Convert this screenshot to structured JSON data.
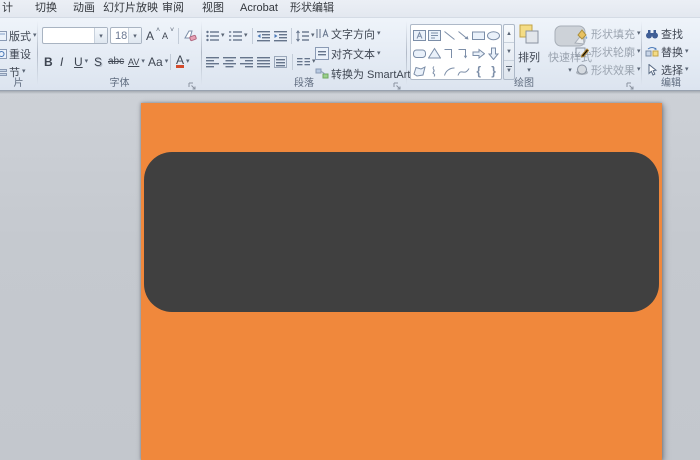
{
  "colors": {
    "slide_background": "#F0883C",
    "shape_fill": "#404040",
    "workspace_gray": "#C7CBD1",
    "ribbon_background": "#E9EFF7"
  },
  "icons": {
    "dd": "▾",
    "up": "▲",
    "down": "▼",
    "caret_up": "˄",
    "caret_down": "˅",
    "lbrace": "{",
    "rbrace": "}"
  },
  "tabs": [
    {
      "label": "计"
    },
    {
      "label": "切换"
    },
    {
      "label": "动画"
    },
    {
      "label": "幻灯片放映"
    },
    {
      "label": "审阅"
    },
    {
      "label": "视图"
    },
    {
      "label": "Acrobat"
    },
    {
      "label": "形状编辑"
    }
  ],
  "ribbon": {
    "slides": {
      "group_label": "片",
      "layout": "版式",
      "reset": "重设",
      "section": "节"
    },
    "font": {
      "group_label": "字体",
      "font_name_value": "",
      "font_size_value": "18",
      "grow_font": "A",
      "shrink_font": "A",
      "bold": "B",
      "italic": "I",
      "underline": "U",
      "shadow": "S",
      "strikethrough": "abc",
      "char_spacing": "AV",
      "change_case": "Aa",
      "font_color": "A"
    },
    "paragraph": {
      "group_label": "段落",
      "text_direction": "文字方向",
      "align_text": "对齐文本",
      "smartart": "转换为 SmartArt"
    },
    "drawing": {
      "group_label": "绘图",
      "arrange": "排列",
      "quick_styles": "快速样式",
      "shape_fill": "形状填充",
      "shape_outline": "形状轮廓",
      "shape_effects": "形状效果"
    },
    "editing": {
      "group_label": "编辑",
      "find": "查找",
      "replace": "替换",
      "select": "选择"
    }
  }
}
